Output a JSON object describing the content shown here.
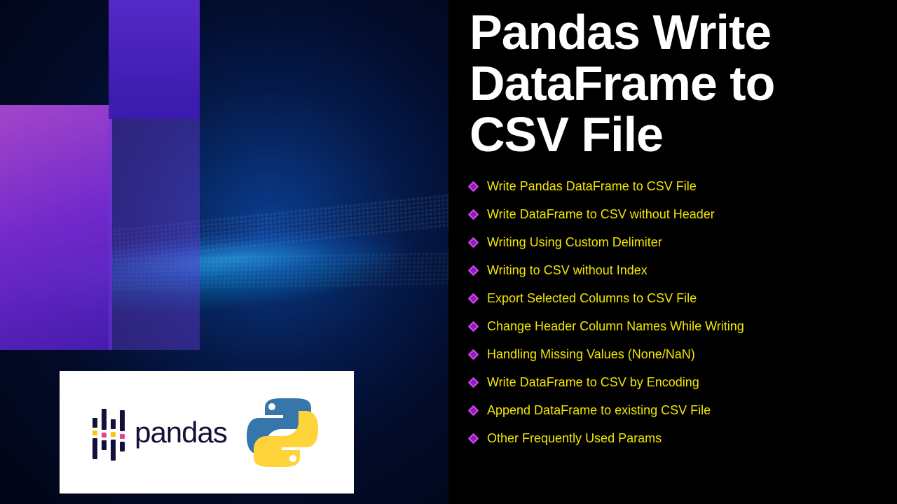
{
  "title": "Pandas Write DataFrame to CSV File",
  "logo_text": "pandas",
  "bullets": [
    "Write Pandas DataFrame to CSV File",
    "Write DataFrame to CSV without Header",
    "Writing Using Custom Delimiter",
    "Writing to CSV without Index",
    "Export Selected Columns to CSV File",
    "Change Header Column Names While Writing",
    "Handling Missing Values (None/NaN)",
    "Write DataFrame to CSV by Encoding",
    "Append DataFrame to existing CSV File",
    "Other Frequently Used Params"
  ],
  "colors": {
    "bullet_text": "#f2e600",
    "diamond": "#d946ef",
    "title": "#ffffff"
  }
}
